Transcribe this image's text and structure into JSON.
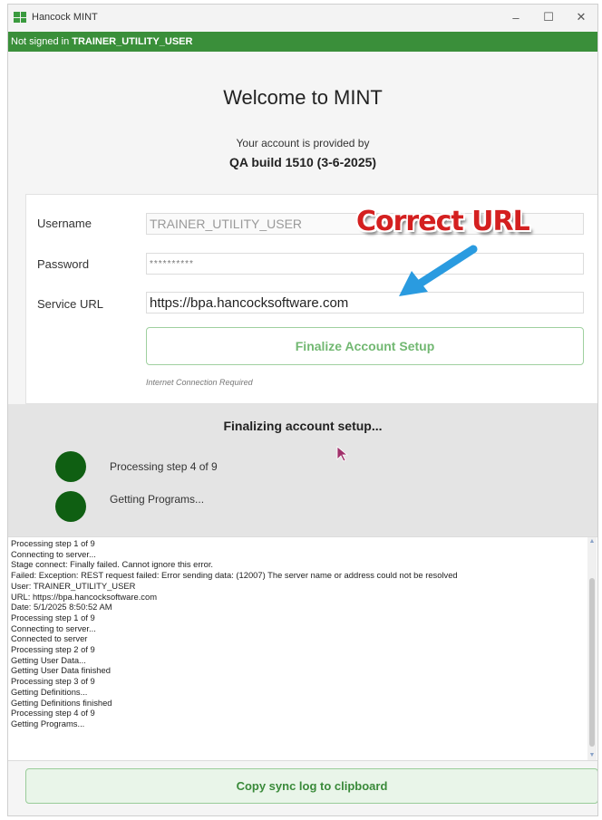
{
  "window": {
    "title": "Hancock MINT",
    "controls": {
      "minimize": "–",
      "maximize": "☐",
      "close": "✕"
    }
  },
  "status_bar": {
    "prefix": "Not signed in",
    "user": "TRAINER_UTILITY_USER",
    "color": "#3a8f3a"
  },
  "header": {
    "title": "Welcome to MINT",
    "provided_by": "Your account is provided by",
    "build": "QA build 1510 (3-6-2025)"
  },
  "form": {
    "username_label": "Username",
    "username_value": "TRAINER_UTILITY_USER",
    "password_label": "Password",
    "password_value": "**********",
    "service_url_label": "Service URL",
    "service_url_value": "https://bpa.hancocksoftware.com",
    "finalize_button": "Finalize Account Setup",
    "hint": "Internet Connection Required"
  },
  "annotation": {
    "text": "Correct URL",
    "color": "#d42020",
    "arrow_color": "#2a9be0"
  },
  "progress": {
    "title": "Finalizing account setup...",
    "step_text": "Processing step 4 of 9",
    "action_text": "Getting Programs...",
    "indicator_color": "#0f5f12"
  },
  "log": {
    "lines": [
      "Processing step 1 of 9",
      "Connecting to server...",
      "Stage connect: Finally failed. Cannot ignore this error.",
      "Failed: Exception: REST request failed: Error sending data: (12007) The server name or address could not be resolved",
      "User: TRAINER_UTILITY_USER",
      "URL: https://bpa.hancocksoftware.com",
      "Date: 5/1/2025 8:50:52 AM",
      "Processing step 1 of 9",
      "Connecting to server...",
      "Connected to server",
      "Processing step 2 of 9",
      "Getting User Data...",
      "Getting User Data finished",
      "Processing step 3 of 9",
      "Getting Definitions...",
      "Getting Definitions finished",
      "Processing step 4 of 9",
      "Getting Programs..."
    ]
  },
  "footer": {
    "copy_button": "Copy sync log to clipboard"
  }
}
